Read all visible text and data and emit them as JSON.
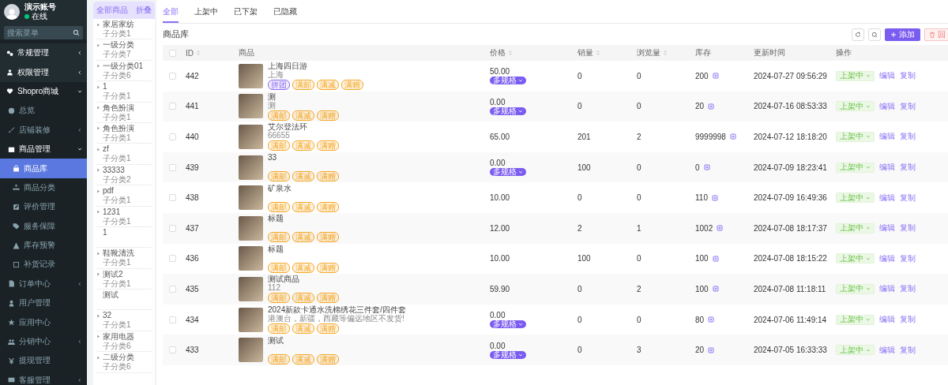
{
  "sidebar": {
    "user": {
      "name": "演示账号",
      "status": "在线"
    },
    "search": {
      "placeholder": "搜索菜单"
    },
    "menu": [
      {
        "label": "常规管理",
        "selected": false,
        "expanded": false
      },
      {
        "label": "权限管理",
        "selected": false,
        "expanded": false
      },
      {
        "label": "Shopro商城",
        "selected": false,
        "expanded": true,
        "children": [
          {
            "label": "总览",
            "selected": false
          },
          {
            "label": "店铺装修",
            "selected": false,
            "expanded": false
          },
          {
            "label": "商品管理",
            "selected": false,
            "expanded": true,
            "children": [
              {
                "label": "商品库",
                "selected": true
              },
              {
                "label": "商品分类",
                "selected": false
              },
              {
                "label": "评价管理",
                "selected": false
              },
              {
                "label": "服务保障",
                "selected": false
              },
              {
                "label": "库存预警",
                "selected": false
              },
              {
                "label": "补货记录",
                "selected": false
              }
            ]
          },
          {
            "label": "订单中心",
            "selected": false,
            "expanded": false
          },
          {
            "label": "用户管理",
            "selected": false
          },
          {
            "label": "应用中心",
            "selected": false
          },
          {
            "label": "分销中心",
            "selected": false,
            "expanded": false
          },
          {
            "label": "提现管理",
            "selected": false
          },
          {
            "label": "客服管理",
            "selected": false,
            "expanded": false
          }
        ]
      }
    ]
  },
  "categories": {
    "title": "全部商品",
    "collapse": "折叠",
    "items": [
      {
        "name": "家居家纺",
        "subtitle": "子分类1"
      },
      {
        "name": "一级分类",
        "subtitle": "子分类7"
      },
      {
        "name": "一级分类01",
        "subtitle": "子分类6"
      },
      {
        "name": "1",
        "subtitle": "子分类1"
      },
      {
        "name": "角色扮演",
        "subtitle": "子分类1"
      },
      {
        "name": "角色扮演",
        "subtitle": "子分类1"
      },
      {
        "name": "zf",
        "subtitle": "子分类1"
      },
      {
        "name": "33333",
        "subtitle": "子分类2"
      },
      {
        "name": "pdf",
        "subtitle": "子分类1"
      },
      {
        "name": "1231",
        "subtitle": "子分类1"
      },
      {
        "name": "1"
      },
      {
        "name": "鞋靴清洗",
        "subtitle": "子分类1"
      },
      {
        "name": "测试2",
        "subtitle": "子分类1"
      },
      {
        "name": "测试"
      },
      {
        "name": "32",
        "subtitle": "子分类1"
      },
      {
        "name": "家用电器",
        "subtitle": "子分类6"
      },
      {
        "name": "二级分类",
        "subtitle": "子分类6"
      }
    ]
  },
  "tabs": [
    {
      "label": "全部",
      "selected": true
    },
    {
      "label": "上架中",
      "selected": false
    },
    {
      "label": "已下架",
      "selected": false
    },
    {
      "label": "已隐藏",
      "selected": false
    }
  ],
  "title": "商品库",
  "toolbar": {
    "add": "添加",
    "recycle": "回"
  },
  "table": {
    "header_checkbox": {
      "checked": false
    },
    "columns": [
      {
        "label": "ID",
        "sortable": true
      },
      {
        "label": "商品",
        "sortable": false
      },
      {
        "label": "价格",
        "sortable": true
      },
      {
        "label": "销量",
        "sortable": true
      },
      {
        "label": "浏览量",
        "sortable": true
      },
      {
        "label": "库存",
        "sortable": false
      },
      {
        "label": "更新时间",
        "sortable": false
      },
      {
        "label": "操作",
        "sortable": false
      }
    ],
    "rows": [
      {
        "checked": false,
        "id": "442",
        "title": "上海四日游",
        "subtitle": "上海",
        "tags": [
          {
            "label": "拼团",
            "color": "#8b6cf0"
          },
          {
            "label": "满邮",
            "color": "#f5a623"
          },
          {
            "label": "满减",
            "color": "#f5a623"
          },
          {
            "label": "满赠",
            "color": "#f5a623"
          }
        ],
        "price": "50.00",
        "spec": "多规格",
        "sales": "0",
        "views": "0",
        "stock": "200",
        "updated": "2024-07-27 09:56:29",
        "status": "上架中",
        "actions": [
          "编辑",
          "复制"
        ]
      },
      {
        "checked": false,
        "id": "441",
        "title": "测",
        "subtitle": "测",
        "tags": [
          {
            "label": "满邮",
            "color": "#f5a623"
          },
          {
            "label": "满减",
            "color": "#f5a623"
          },
          {
            "label": "满赠",
            "color": "#f5a623"
          }
        ],
        "price": "0.00",
        "spec": "多规格",
        "sales": "0",
        "views": "0",
        "stock": "20",
        "updated": "2024-07-16 08:53:33",
        "status": "上架中",
        "actions": [
          "编辑",
          "复制"
        ]
      },
      {
        "checked": false,
        "id": "440",
        "title": "艾尔登法环",
        "subtitle": "66655",
        "tags": [
          {
            "label": "满邮",
            "color": "#f5a623"
          },
          {
            "label": "满减",
            "color": "#f5a623"
          },
          {
            "label": "满赠",
            "color": "#f5a623"
          }
        ],
        "price": "65.00",
        "sales": "201",
        "views": "2",
        "stock": "9999998",
        "updated": "2024-07-12 18:18:20",
        "status": "上架中",
        "actions": [
          "编辑",
          "复制"
        ]
      },
      {
        "checked": false,
        "id": "439",
        "title": "33",
        "tags": [
          {
            "label": "满邮",
            "color": "#f5a623"
          },
          {
            "label": "满减",
            "color": "#f5a623"
          },
          {
            "label": "满赠",
            "color": "#f5a623"
          }
        ],
        "price": "0.00",
        "spec": "多规格",
        "sales": "100",
        "views": "0",
        "stock": "0",
        "updated": "2024-07-09 18:23:41",
        "status": "上架中",
        "actions": [
          "编辑",
          "复制"
        ]
      },
      {
        "checked": false,
        "id": "438",
        "title": "矿泉水",
        "tags": [
          {
            "label": "满邮",
            "color": "#f5a623"
          },
          {
            "label": "满减",
            "color": "#f5a623"
          },
          {
            "label": "满赠",
            "color": "#f5a623"
          }
        ],
        "price": "10.00",
        "sales": "0",
        "views": "0",
        "stock": "110",
        "updated": "2024-07-09 16:49:36",
        "status": "上架中",
        "actions": [
          "编辑",
          "复制"
        ]
      },
      {
        "checked": false,
        "id": "437",
        "title": "标题",
        "tags": [
          {
            "label": "满邮",
            "color": "#f5a623"
          },
          {
            "label": "满减",
            "color": "#f5a623"
          },
          {
            "label": "满赠",
            "color": "#f5a623"
          }
        ],
        "price": "12.00",
        "sales": "2",
        "views": "1",
        "stock": "1002",
        "updated": "2024-07-08 18:17:37",
        "status": "上架中",
        "actions": [
          "编辑",
          "复制"
        ]
      },
      {
        "checked": false,
        "id": "436",
        "title": "标题",
        "tags": [
          {
            "label": "满邮",
            "color": "#f5a623"
          },
          {
            "label": "满减",
            "color": "#f5a623"
          },
          {
            "label": "满赠",
            "color": "#f5a623"
          }
        ],
        "price": "10.00",
        "sales": "100",
        "views": "0",
        "stock": "100",
        "updated": "2024-07-08 18:15:22",
        "status": "上架中",
        "actions": [
          "编辑",
          "复制"
        ]
      },
      {
        "checked": false,
        "id": "435",
        "title": "测试商品",
        "subtitle": "112",
        "tags": [
          {
            "label": "满邮",
            "color": "#f5a623"
          },
          {
            "label": "满减",
            "color": "#f5a623"
          },
          {
            "label": "满赠",
            "color": "#f5a623"
          }
        ],
        "price": "59.90",
        "sales": "0",
        "views": "2",
        "stock": "100",
        "updated": "2024-07-08 11:18:11",
        "status": "上架中",
        "actions": [
          "编辑",
          "复制"
        ]
      },
      {
        "checked": false,
        "id": "434",
        "title": "2024新款卡通水洗棉绣花三件套/四件套",
        "subtitle": "港澳台，新疆，西藏等偏远地区不发货!",
        "tags": [
          {
            "label": "满邮",
            "color": "#f5a623"
          },
          {
            "label": "满减",
            "color": "#f5a623"
          },
          {
            "label": "满赠",
            "color": "#f5a623"
          }
        ],
        "price": "0.00",
        "spec": "多规格",
        "sales": "0",
        "views": "0",
        "stock": "80",
        "updated": "2024-07-06 11:49:14",
        "status": "上架中",
        "actions": [
          "编辑",
          "复制"
        ]
      },
      {
        "checked": false,
        "id": "433",
        "title": "测试",
        "tags": [
          {
            "label": "满邮",
            "color": "#f5a623"
          },
          {
            "label": "满减",
            "color": "#f5a623"
          },
          {
            "label": "满赠",
            "color": "#f5a623"
          }
        ],
        "price": "0.00",
        "spec": "多规格",
        "sales": "0",
        "views": "3",
        "stock": "20",
        "updated": "2024-07-05 16:33:33",
        "status": "上架中",
        "actions": [
          "编辑",
          "复制"
        ]
      }
    ]
  }
}
